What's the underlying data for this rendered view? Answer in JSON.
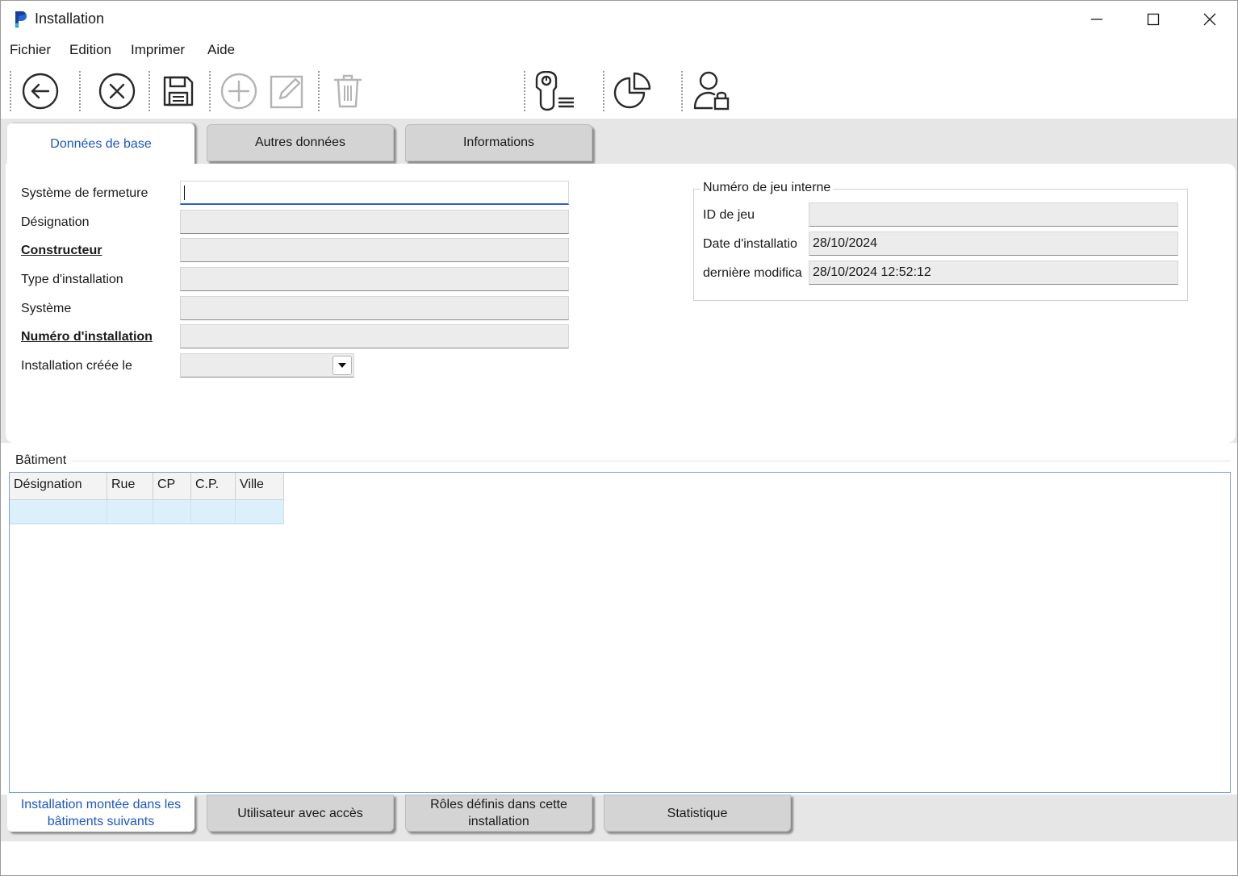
{
  "window": {
    "title": "Installation"
  },
  "menu": [
    "Fichier",
    "Edition",
    "Imprimer",
    "Aide"
  ],
  "toolbar": {
    "icons": [
      "back-arrow-icon",
      "cancel-icon",
      "save-icon",
      "add-icon",
      "edit-icon",
      "delete-icon",
      "key-list-icon",
      "pie-chart-icon",
      "user-lock-icon"
    ]
  },
  "tabs": [
    "Données de base",
    "Autres données",
    "Informations"
  ],
  "form": {
    "labels": {
      "systeme_fermeture": "Système de fermeture",
      "designation": "Désignation",
      "constructeur": "Constructeur",
      "type_installation": "Type d'installation",
      "systeme": "Système",
      "numero_installation": "Numéro d'installation",
      "installation_creee": "Installation créée le"
    },
    "values": {
      "systeme_fermeture": "",
      "designation": "",
      "constructeur": "",
      "type_installation": "",
      "systeme": "",
      "numero_installation": "",
      "installation_creee": ""
    }
  },
  "group": {
    "title": "Numéro de jeu interne",
    "id_jeu_label": "ID de jeu",
    "id_jeu_value": "",
    "date_install_label": "Date d'installatio",
    "date_install_value": "28/10/2024",
    "derniere_modif_label": "dernière modifica",
    "derniere_modif_value": "28/10/2024 12:52:12"
  },
  "batiment": {
    "title": "Bâtiment",
    "columns": [
      "Désignation",
      "Rue",
      "CP",
      "C.P.",
      "Ville"
    ]
  },
  "bottom_tabs": [
    [
      "Installation montée dans les",
      "bâtiments suivants"
    ],
    [
      "Utilisateur avec accès",
      ""
    ],
    [
      "Rôles définis dans cette",
      "installation"
    ],
    [
      "Statistique",
      ""
    ]
  ],
  "colors": {
    "accent": "#1b56c9",
    "selection": "#dcf0fb"
  }
}
